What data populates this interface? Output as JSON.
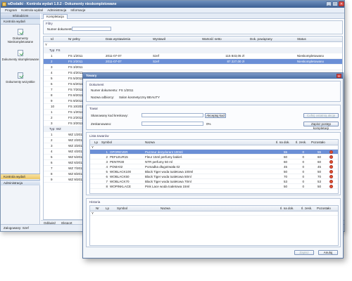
{
  "window": {
    "title": "wDodatki - Kontrola wydań 1.0.2 - Dokumenty nieskompletowane"
  },
  "menu": [
    "Program",
    "Kontrola wydań",
    "Administracja",
    "Informacje"
  ],
  "sidebar": {
    "header": "Infolodzizm",
    "section": "Kontrola wydań",
    "items": [
      {
        "label": "Dokumenty Nieskompletowane"
      },
      {
        "label": "Dokumenty skompletowane"
      },
      {
        "label": "Dokumenty wszystkie"
      }
    ],
    "bottom": [
      {
        "label": "Kontrola wydań"
      },
      {
        "label": "Administracja"
      }
    ]
  },
  "tab": {
    "label": "Kompletacja"
  },
  "filter": {
    "title": "Filtry",
    "label": "Numer dokumentu:",
    "value": ""
  },
  "grid": {
    "columns": [
      "Id",
      "Nr pełny",
      "Data wystawienia",
      "Wystawił",
      "Wartość netto",
      "Dok. powiązany",
      "Status"
    ],
    "groups": [
      {
        "label": "Typ: FS",
        "rows": [
          {
            "id": "1",
            "nr": "FS 1/2011",
            "data": "2011-07-07",
            "wyst": "Szef",
            "netto": "115 843,05 zł",
            "dok": "",
            "status": "Nieskompletowano",
            "sel": false
          },
          {
            "id": "2",
            "nr": "FS 2/2011",
            "data": "2011-07-07",
            "wyst": "Szef",
            "netto": "87 227,00 zł",
            "dok": "",
            "status": "Nieskompletowano",
            "sel": true
          },
          {
            "id": "3",
            "nr": "FS 3/2011",
            "data": "",
            "wyst": "",
            "netto": "",
            "dok": "",
            "status": "",
            "sel": false
          },
          {
            "id": "4",
            "nr": "FS 4/2011",
            "data": "",
            "wyst": "",
            "netto": "",
            "dok": "",
            "status": "",
            "sel": false
          },
          {
            "id": "5",
            "nr": "FS 5/2011",
            "data": "",
            "wyst": "",
            "netto": "",
            "dok": "",
            "status": "",
            "sel": false
          },
          {
            "id": "6",
            "nr": "FS 6/2011",
            "data": "",
            "wyst": "",
            "netto": "",
            "dok": "",
            "status": "",
            "sel": false
          },
          {
            "id": "7",
            "nr": "FS 7/2011",
            "data": "",
            "wyst": "",
            "netto": "",
            "dok": "",
            "status": "",
            "sel": false
          },
          {
            "id": "8",
            "nr": "FS 8/2011",
            "data": "",
            "wyst": "",
            "netto": "",
            "dok": "",
            "status": "",
            "sel": false
          },
          {
            "id": "9",
            "nr": "FS 9/2011",
            "data": "",
            "wyst": "",
            "netto": "",
            "dok": "",
            "status": "",
            "sel": false
          },
          {
            "id": "10",
            "nr": "FS 10/2011",
            "data": "",
            "wyst": "",
            "netto": "",
            "dok": "",
            "status": "",
            "sel": false
          },
          {
            "id": "1",
            "nr": "FS 1/2012",
            "data": "",
            "wyst": "",
            "netto": "",
            "dok": "",
            "status": "",
            "sel": false
          },
          {
            "id": "2",
            "nr": "FS 2/2012",
            "data": "",
            "wyst": "",
            "netto": "",
            "dok": "",
            "status": "",
            "sel": false
          },
          {
            "id": "3",
            "nr": "FS 3/2012",
            "data": "",
            "wyst": "",
            "netto": "",
            "dok": "",
            "status": "",
            "sel": false
          }
        ]
      },
      {
        "label": "Typ: WZ",
        "rows": [
          {
            "id": "1",
            "nr": "WZ 1/2011"
          },
          {
            "id": "2",
            "nr": "WZ 2/2011"
          },
          {
            "id": "3",
            "nr": "WZ 3/2011"
          },
          {
            "id": "4",
            "nr": "WZ 4/2011"
          },
          {
            "id": "5",
            "nr": "WZ 5/2011"
          },
          {
            "id": "6",
            "nr": "WZ 6/2011"
          },
          {
            "id": "7",
            "nr": "WZ 7/2011"
          },
          {
            "id": "8",
            "nr": "WZ 8/2011"
          },
          {
            "id": "9",
            "nr": "WZ 9/2011"
          }
        ]
      }
    ]
  },
  "toolbar": {
    "refresh": "Odśwież",
    "export": "Eksport"
  },
  "status": {
    "text": "Zalogowany: Szef"
  },
  "modal": {
    "title": "Towary",
    "doc_section": "Dokument",
    "doc_number_label": "Numer dokumentu:",
    "doc_number": "FS 1/2011",
    "recipient_label": "Nazwa odbiorcy:",
    "recipient": "Salon kosmetyczny BEAUTY",
    "towar_section": "Towar",
    "scan_label": "Skanowany kod kreskowy:",
    "scan_value": "",
    "scan_button": "Akceptuj kod",
    "cancel_scan_button": "Cofnij ostatnią akcję",
    "progress_label": "Zeskanowano:",
    "progress_value": "0%",
    "progress_fraction": 0,
    "save_button": "Zapisz postęp kompletacji",
    "list_section": "Lista towarów",
    "list_columns": [
      "Lp",
      "Symbol",
      "Nazwa",
      "Il. na dok.",
      "Il. zesk.",
      "Pozostało"
    ],
    "items": [
      {
        "lp": "1",
        "symbol": "OPOREVER",
        "nazwa": "Puzzeur dezydorant 100ml",
        "ildok": "55",
        "ilzesk": "0",
        "poz": "55",
        "sel": true
      },
      {
        "lp": "2",
        "symbol": "PEFLEUR15",
        "nazwa": "Fleur 15ml perfumy bakieł.",
        "ildok": "60",
        "ilzesk": "0",
        "poz": "60",
        "sel": false
      },
      {
        "lp": "3",
        "symbol": "PENTR30",
        "nazwa": "NTR perfumy 50 ml",
        "ildok": "60",
        "ilzesk": "0",
        "poz": "60",
        "sel": false
      },
      {
        "lp": "4",
        "symbol": "POMA02",
        "nazwa": "Pomadka długotrwała 02",
        "ildok": "45",
        "ilzesk": "0",
        "poz": "45",
        "sel": false
      },
      {
        "lp": "5",
        "symbol": "WOBLACK100",
        "nazwa": "Black Tiger woda toaletowa 100ml",
        "ildok": "50",
        "ilzesk": "0",
        "poz": "50",
        "sel": false
      },
      {
        "lp": "6",
        "symbol": "WOBLACK50",
        "nazwa": "Black Tiger woda toaletowa 50ml",
        "ildok": "70",
        "ilzesk": "0",
        "poz": "70",
        "sel": false
      },
      {
        "lp": "7",
        "symbol": "WOBLACK70",
        "nazwa": "Black Tiger woda toaletowa 70ml",
        "ildok": "53",
        "ilzesk": "0",
        "poz": "53",
        "sel": false
      },
      {
        "lp": "8",
        "symbol": "WOPINKLACE",
        "nazwa": "Pink Lace woda toaletowa 15ml",
        "ildok": "50",
        "ilzesk": "0",
        "poz": "50",
        "sel": false
      }
    ],
    "history_section": "Historia",
    "history_columns": [
      "Nr",
      "Lp",
      "Symbol",
      "Nazwa",
      "Il. na dok.",
      "Il. zesk.",
      "Pozostało"
    ],
    "ok_button": "Zapisz",
    "cancel_button": "Anuluj"
  }
}
